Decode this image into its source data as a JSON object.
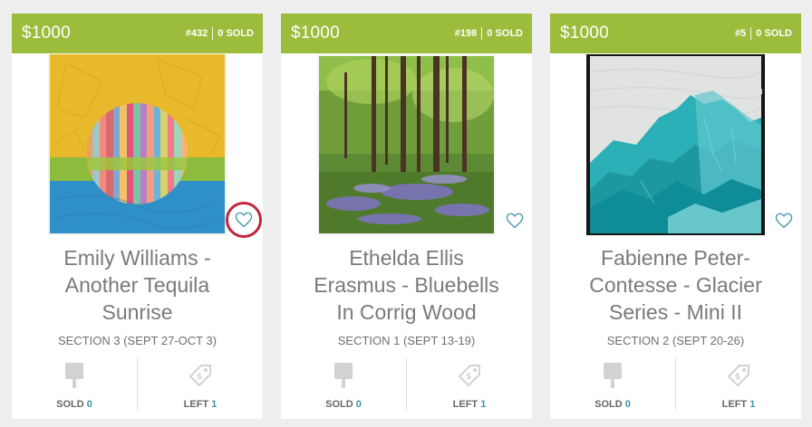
{
  "cards": [
    {
      "price": "$1000",
      "number": "#432",
      "sold_badge": "0 SOLD",
      "title_lines": [
        "Emily Williams -",
        "Another Tequila",
        "Sunrise"
      ],
      "section": "SECTION 3 (SEPT 27-OCT 3)",
      "sold_label": "SOLD",
      "sold_count": "0",
      "left_label": "LEFT",
      "left_count": "1",
      "favorite_icon": "heart-outline-icon"
    },
    {
      "price": "$1000",
      "number": "#198",
      "sold_badge": "0 SOLD",
      "title_lines": [
        "Ethelda Ellis",
        "Erasmus - Bluebells",
        "In Corrig Wood"
      ],
      "section": "SECTION 1 (SEPT 13-19)",
      "sold_label": "SOLD",
      "sold_count": "0",
      "left_label": "LEFT",
      "left_count": "1",
      "favorite_icon": "heart-outline-icon"
    },
    {
      "price": "$1000",
      "number": "#5",
      "sold_badge": "0 SOLD",
      "title_lines": [
        "Fabienne Peter-",
        "Contesse - Glacier",
        "Series - Mini II"
      ],
      "section": "SECTION 2 (SEPT 20-26)",
      "sold_label": "SOLD",
      "sold_count": "0",
      "left_label": "LEFT",
      "left_count": "1",
      "favorite_icon": "heart-outline-icon"
    }
  ],
  "colors": {
    "header_green": "#9cbc3b",
    "accent_teal": "#3c94ab",
    "highlight_red": "#c2253f"
  }
}
